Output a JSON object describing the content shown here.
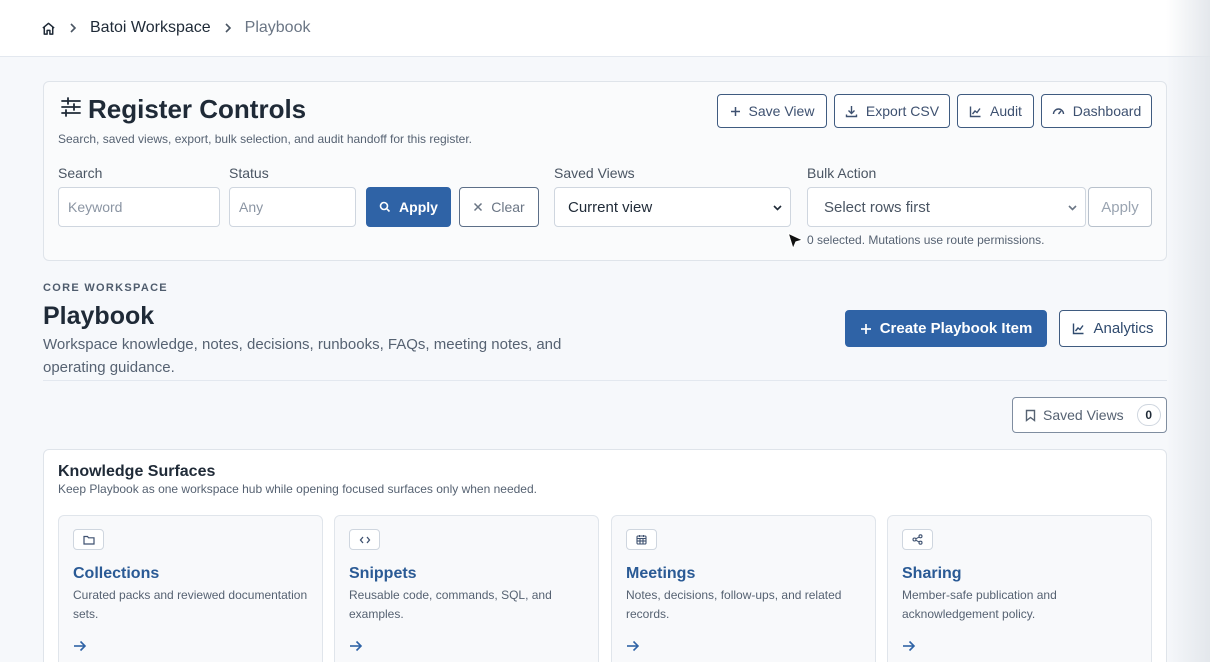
{
  "breadcrumb": {
    "home_icon": "home-icon",
    "workspace": "Batoi Workspace",
    "current": "Playbook"
  },
  "register": {
    "icon": "sliders-icon",
    "title": "Register Controls",
    "subtitle": "Search, saved views, export, bulk selection, and audit handoff for this register.",
    "actions": {
      "save_view": "Save View",
      "export_csv": "Export CSV",
      "audit": "Audit",
      "dashboard": "Dashboard"
    },
    "search": {
      "label": "Search",
      "placeholder": "Keyword"
    },
    "status": {
      "label": "Status",
      "placeholder": "Any"
    },
    "apply": "Apply",
    "clear": "Clear",
    "saved_views": {
      "label": "Saved Views",
      "value": "Current view"
    },
    "bulk_action": {
      "label": "Bulk Action",
      "value": "Select rows first",
      "apply": "Apply"
    },
    "selection_hint": "0 selected. Mutations use route permissions."
  },
  "page": {
    "eyebrow": "CORE WORKSPACE",
    "title": "Playbook",
    "description": "Workspace knowledge, notes, decisions, runbooks, FAQs, meeting notes, and operating guidance.",
    "create_button": "Create Playbook Item",
    "analytics_button": "Analytics",
    "saved_views_button": "Saved Views",
    "saved_views_count": "0"
  },
  "knowledge_surfaces": {
    "title": "Knowledge Surfaces",
    "subtitle": "Keep Playbook as one workspace hub while opening focused surfaces only when needed.",
    "tiles": [
      {
        "icon": "folder-icon",
        "name": "Collections",
        "description": "Curated packs and reviewed documentation sets."
      },
      {
        "icon": "code-icon",
        "name": "Snippets",
        "description": "Reusable code, commands, SQL, and examples."
      },
      {
        "icon": "calendar-icon",
        "name": "Meetings",
        "description": "Notes, decisions, follow-ups, and related records."
      },
      {
        "icon": "share-icon",
        "name": "Sharing",
        "description": "Member-safe publication and acknowledgement policy."
      }
    ]
  },
  "colors": {
    "primary": "#2f63a6",
    "link": "#2a5a95",
    "background": "#f6f8fb"
  }
}
